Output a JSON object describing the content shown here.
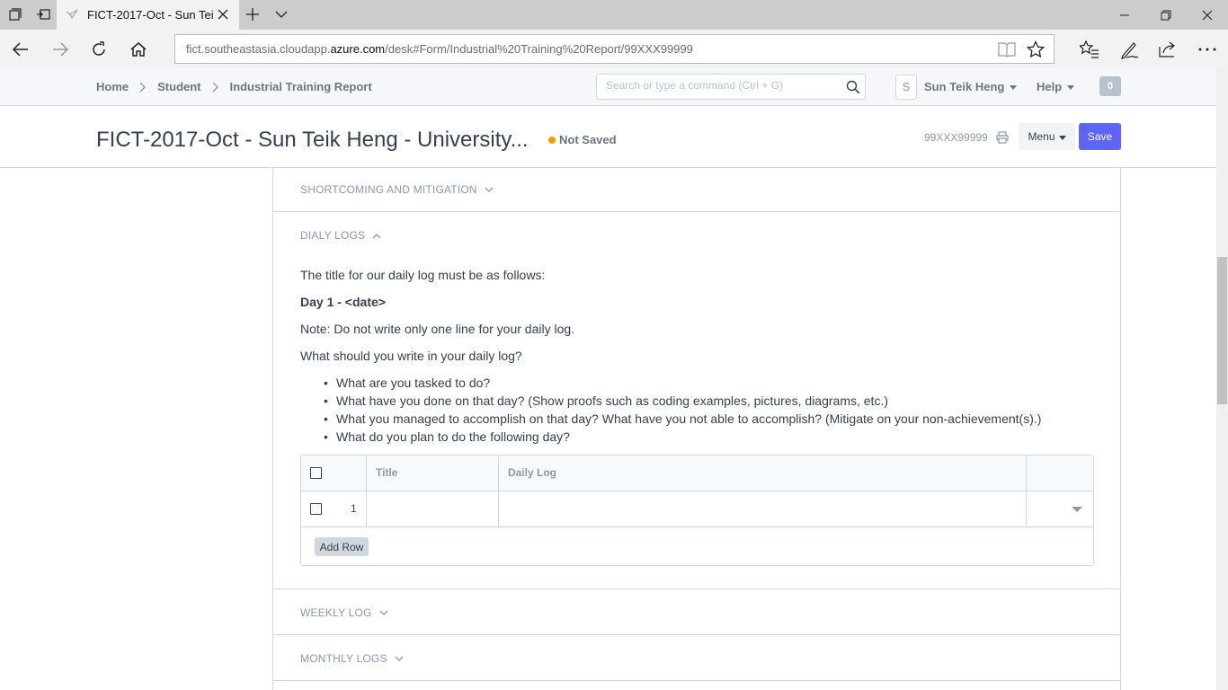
{
  "browser": {
    "tab_title": "FICT-2017-Oct - Sun Tei",
    "url_prefix": "fict.southeastasia.cloudapp.",
    "url_domain": "azure.com",
    "url_path": "/desk#Form/Industrial%20Training%20Report/99XXX99999"
  },
  "header": {
    "breadcrumbs": [
      "Home",
      "Student",
      "Industrial Training Report"
    ],
    "search_placeholder": "Search or type a command (Ctrl + G)",
    "avatar_initial": "S",
    "user_name": "Sun Teik Heng",
    "help_label": "Help",
    "notification_count": "0"
  },
  "page": {
    "title": "FICT-2017-Oct - Sun Teik Heng - University...",
    "status": "Not Saved",
    "status_color": "#ff9800",
    "doc_name": "99XXX99999",
    "menu_label": "Menu",
    "save_label": "Save",
    "accent_color": "#5e64ff"
  },
  "sections": {
    "shortcoming": "SHORTCOMING AND MITIGATION",
    "daily_logs": "DIALY LOGS",
    "weekly_log": "WEEKLY LOG",
    "monthly_logs": "MONTHLY LOGS"
  },
  "daily": {
    "intro": "The title for our daily log must be as follows:",
    "title_format": "Day 1 - <date>",
    "note": "Note: Do not write only one line for your daily log.",
    "question": "What should you write in your daily log?",
    "bullets": [
      "What are you tasked to do?",
      "What have you done on that day? (Show proofs such as coding examples, pictures, diagrams, etc.)",
      "What you managed to accomplish on that day? What have you not able to accomplish? (Mitigate on your non-achievement(s).)",
      "What do you plan to do the following day?"
    ]
  },
  "grid": {
    "columns": [
      "Title",
      "Daily Log"
    ],
    "rows": [
      {
        "idx": "1",
        "title": "",
        "daily_log": ""
      }
    ],
    "add_row_label": "Add Row"
  }
}
